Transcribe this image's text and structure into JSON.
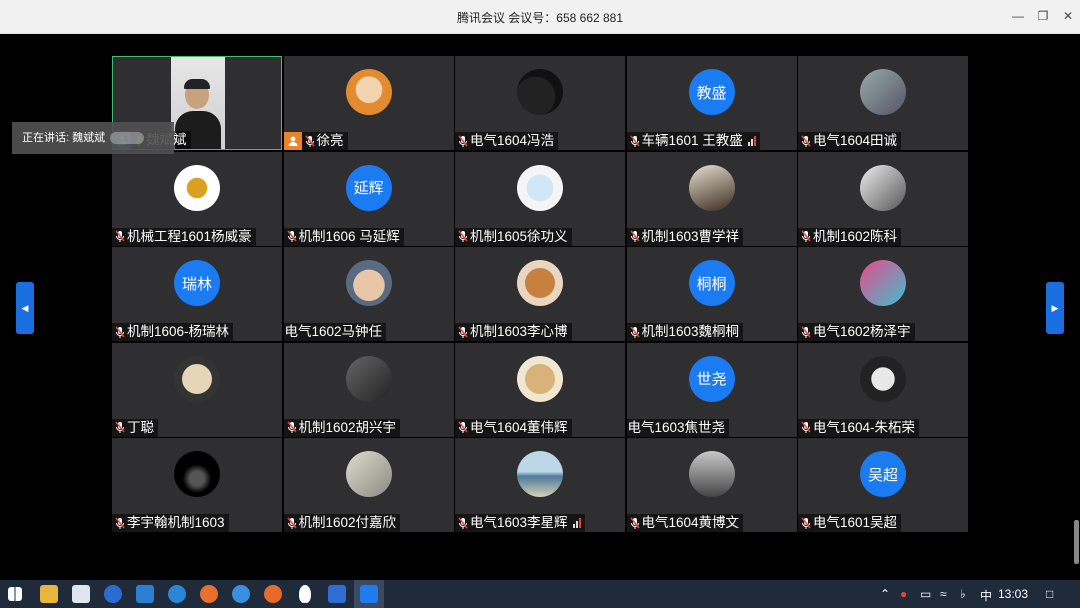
{
  "window": {
    "title": "腾讯会议 会议号：658 662 881",
    "controls": [
      "minimize-icon",
      "restore-icon",
      "close-icon"
    ]
  },
  "speaking": {
    "label": "正在讲话: 魏斌斌"
  },
  "colors": {
    "avatar_blue": "#1a7bf2",
    "tile_bg": "#2f2f31",
    "self_border": "#3fbf6f",
    "mic_red": "#e0453a"
  },
  "participants": [
    {
      "name": "魏斌斌",
      "avatar": "video",
      "mic": "on",
      "host": true,
      "self": true
    },
    {
      "name": "徐亮",
      "avatar": "img-cartoon",
      "mic": "muted",
      "cohost": true
    },
    {
      "name": "电气1604冯浩",
      "avatar": "img-dark",
      "mic": "muted"
    },
    {
      "name": "车辆1601 王教盛",
      "avatar": "text",
      "avatar_text": "教盛",
      "mic": "muted",
      "signal": true
    },
    {
      "name": "电气1604田诚",
      "avatar": "img-figure",
      "mic": "muted"
    },
    {
      "name": "机械工程1601杨威豪",
      "avatar": "img-bird",
      "mic": "muted"
    },
    {
      "name": "机制1606 马延辉",
      "avatar": "text",
      "avatar_text": "延辉",
      "mic": "muted"
    },
    {
      "name": "机制1605徐功义",
      "avatar": "img-sketch",
      "mic": "muted"
    },
    {
      "name": "机制1603曹学祥",
      "avatar": "img-anime",
      "mic": "muted"
    },
    {
      "name": "机制1602陈科",
      "avatar": "img-bw",
      "mic": "muted"
    },
    {
      "name": "机制1606-杨瑞林",
      "avatar": "text",
      "avatar_text": "瑞林",
      "mic": "muted"
    },
    {
      "name": "电气1602马钟任",
      "avatar": "img-kid",
      "mic": "none"
    },
    {
      "name": "机制1603李心博",
      "avatar": "img-dog",
      "mic": "muted"
    },
    {
      "name": "机制1603魏桐桐",
      "avatar": "text",
      "avatar_text": "桐桐",
      "mic": "muted"
    },
    {
      "name": "电气1602杨泽宇",
      "avatar": "img-logo",
      "mic": "muted"
    },
    {
      "name": "丁聪",
      "avatar": "img-boy",
      "mic": "muted"
    },
    {
      "name": "机制1602胡兴宇",
      "avatar": "img-gray",
      "mic": "muted"
    },
    {
      "name": "电气1604董伟辉",
      "avatar": "img-monkey",
      "mic": "muted"
    },
    {
      "name": "电气1603焦世尧",
      "avatar": "text",
      "avatar_text": "世尧",
      "mic": "none"
    },
    {
      "name": "电气1604-朱柘荣",
      "avatar": "img-cat",
      "mic": "muted"
    },
    {
      "name": "李宇翰机制1603",
      "avatar": "img-night",
      "mic": "muted"
    },
    {
      "name": "机制1602付嘉欣",
      "avatar": "img-soft",
      "mic": "muted"
    },
    {
      "name": "电气1603李星辉",
      "avatar": "img-beach",
      "mic": "muted",
      "signal": true
    },
    {
      "name": "电气1604黄博文",
      "avatar": "img-street",
      "mic": "muted"
    },
    {
      "name": "电气1601吴超",
      "avatar": "text",
      "avatar_text": "吴超",
      "mic": "muted"
    }
  ],
  "taskbar": {
    "pinned": [
      "windows-start-icon",
      "file-explorer-icon",
      "store-icon",
      "app-l-icon",
      "mail-icon",
      "app-k-icon",
      "firefox-icon",
      "edge-icon",
      "firefox-alt-icon",
      "qq-icon",
      "word-icon",
      "tencent-meeting-icon"
    ],
    "tray": {
      "ime": "中",
      "time": "13:03"
    }
  }
}
